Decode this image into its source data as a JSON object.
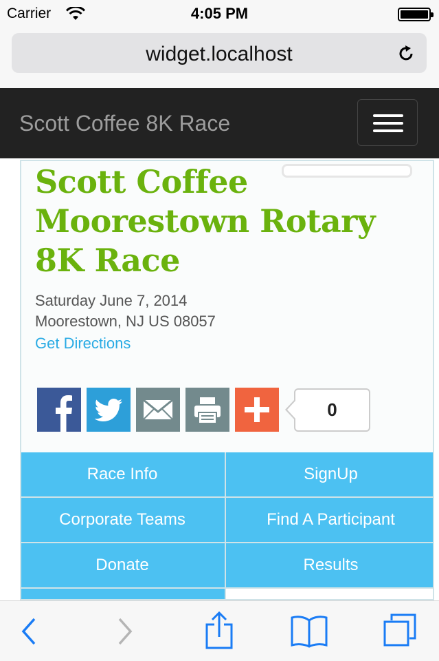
{
  "status_bar": {
    "carrier": "Carrier",
    "time": "4:05 PM",
    "battery_level": 1.0
  },
  "browser": {
    "url": "widget.localhost",
    "reload_icon": "reload-icon"
  },
  "navbar": {
    "brand": "Scott Coffee 8K Race",
    "toggle_icon": "hamburger-menu-icon"
  },
  "race": {
    "title": "Scott Coffee Moorestown Rotary 8K Race",
    "date": "Saturday June 7, 2014",
    "location": "Moorestown, NJ US 08057",
    "directions_label": "Get Directions"
  },
  "share": {
    "buttons": [
      {
        "icon": "facebook-icon",
        "color": "#3b5998"
      },
      {
        "icon": "twitter-icon",
        "color": "#2d9fd9"
      },
      {
        "icon": "email-icon",
        "color": "#738a8d"
      },
      {
        "icon": "print-icon",
        "color": "#738a8d"
      },
      {
        "icon": "plus-icon",
        "color": "#f0643f"
      }
    ],
    "count": "0"
  },
  "menu": {
    "items": [
      {
        "label": "Race Info"
      },
      {
        "label": "SignUp"
      },
      {
        "label": "Corporate Teams"
      },
      {
        "label": "Find A Participant"
      },
      {
        "label": "Donate"
      },
      {
        "label": "Results"
      }
    ]
  },
  "colors": {
    "accent_green": "#6ab20d",
    "menu_blue": "#4cc1f2",
    "link_blue": "#2aabe4",
    "navbar_bg": "#222222"
  },
  "toolbar": {
    "icons": [
      "back-icon",
      "forward-icon",
      "share-icon",
      "bookmarks-icon",
      "tabs-icon"
    ]
  }
}
